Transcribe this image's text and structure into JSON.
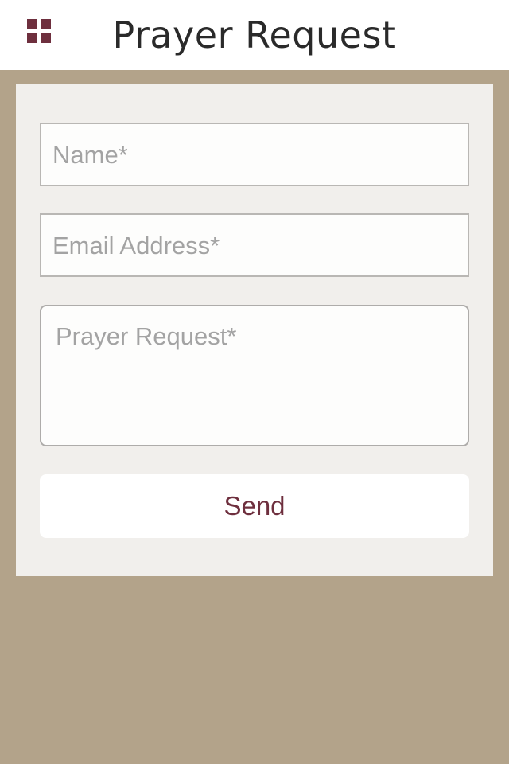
{
  "colors": {
    "accent": "#6e2f3e",
    "background": "#b3a38a",
    "card": "#f1efec",
    "header": "#ffffff"
  },
  "header": {
    "menu_icon": "grid-menu-icon",
    "title": "Prayer Request"
  },
  "form": {
    "name_placeholder": "Name*",
    "email_placeholder": "Email Address*",
    "prayer_placeholder": "Prayer Request*",
    "send_label": "Send"
  }
}
